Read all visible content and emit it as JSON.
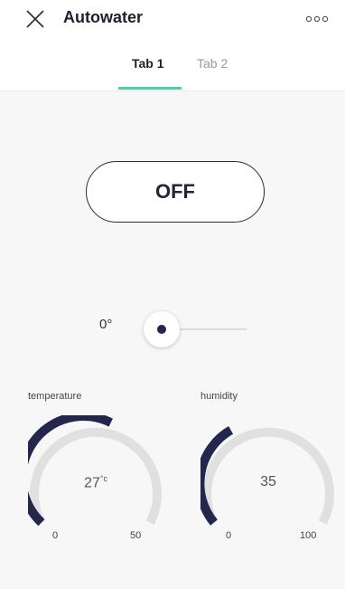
{
  "header": {
    "title": "Autowater",
    "close_icon": "close-icon",
    "more_icon": "more-horizontal-icon"
  },
  "tabs": [
    {
      "label": "Tab 1",
      "active": true
    },
    {
      "label": "Tab 2",
      "active": false
    }
  ],
  "power_button": {
    "label": "OFF"
  },
  "slider": {
    "value_text": "0°",
    "value": 0
  },
  "gauges": {
    "temperature": {
      "label": "temperature",
      "value": "27",
      "unit": "°c",
      "min": "0",
      "max": "50"
    },
    "humidity": {
      "label": "humidity",
      "value": "35",
      "min": "0",
      "max": "100"
    }
  },
  "colors": {
    "accent": "#5fc7a7",
    "gauge_fill": "#23264d",
    "gauge_track": "#e0e0e0"
  }
}
